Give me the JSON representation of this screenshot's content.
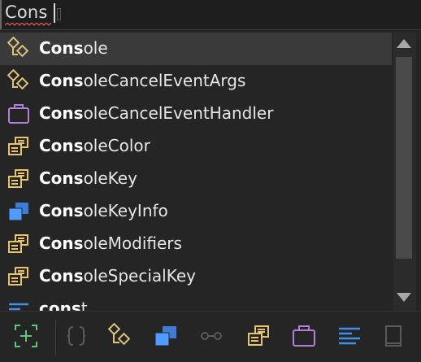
{
  "editor": {
    "typed_text": "Cons"
  },
  "completions": [
    {
      "match": "Cons",
      "rest": "ole",
      "icon": "class-icon",
      "selected": true
    },
    {
      "match": "Cons",
      "rest": "oleCancelEventArgs",
      "icon": "class-icon",
      "selected": false
    },
    {
      "match": "Cons",
      "rest": "oleCancelEventHandler",
      "icon": "delegate-icon",
      "selected": false
    },
    {
      "match": "Cons",
      "rest": "oleColor",
      "icon": "enum-icon",
      "selected": false
    },
    {
      "match": "Cons",
      "rest": "oleKey",
      "icon": "enum-icon",
      "selected": false
    },
    {
      "match": "Cons",
      "rest": "oleKeyInfo",
      "icon": "struct-icon",
      "selected": false
    },
    {
      "match": "Cons",
      "rest": "oleModifiers",
      "icon": "enum-icon",
      "selected": false
    },
    {
      "match": "Cons",
      "rest": "oleSpecialKey",
      "icon": "enum-icon",
      "selected": false
    },
    {
      "match": "cons",
      "rest": "t",
      "icon": "keyword-icon",
      "selected": false
    }
  ],
  "filters": [
    {
      "icon": "expand-items-icon",
      "enabled": true
    },
    {
      "icon": "namespace-filter-icon",
      "enabled": false
    },
    {
      "icon": "class-filter-icon",
      "enabled": true
    },
    {
      "icon": "struct-filter-icon",
      "enabled": true
    },
    {
      "icon": "interface-filter-icon",
      "enabled": false
    },
    {
      "icon": "enum-filter-icon",
      "enabled": true
    },
    {
      "icon": "delegate-filter-icon",
      "enabled": true
    },
    {
      "icon": "keyword-filter-icon",
      "enabled": true
    },
    {
      "icon": "snippet-filter-icon",
      "enabled": false
    }
  ],
  "colors": {
    "class": "#dcc37a",
    "delegate": "#b180d7",
    "enum": "#e8c56a",
    "struct": "#4f9bff",
    "keyword": "#3f8ee8",
    "expand": "#5ec97a",
    "disabled": "#5a5a5a"
  }
}
